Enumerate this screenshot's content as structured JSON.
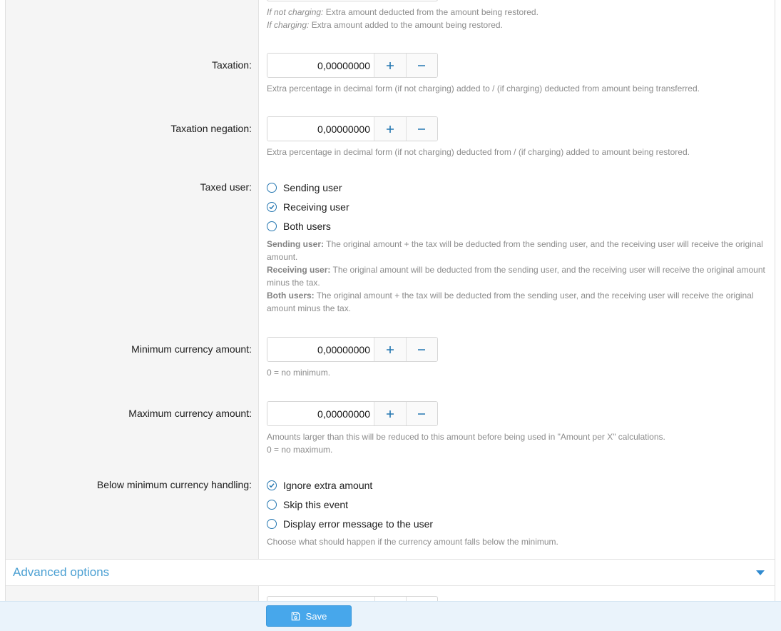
{
  "top_hint": {
    "not_charging_label": "If not charging:",
    "not_charging_text": " Extra amount deducted from the amount being restored.",
    "charging_label": "If charging:",
    "charging_text": " Extra amount added to the amount being restored."
  },
  "taxation": {
    "label": "Taxation:",
    "value": "0,00000000",
    "hint": "Extra percentage in decimal form (if not charging) added to / (if charging) deducted from amount being transferred."
  },
  "taxation_negation": {
    "label": "Taxation negation:",
    "value": "0,00000000",
    "hint": "Extra percentage in decimal form (if not charging) deducted from / (if charging) added to amount being restored."
  },
  "taxed_user": {
    "label": "Taxed user:",
    "options": [
      {
        "label": "Sending user",
        "selected": false
      },
      {
        "label": "Receiving user",
        "selected": true
      },
      {
        "label": "Both users",
        "selected": false
      }
    ],
    "hint_sending_label": "Sending user:",
    "hint_sending_text": " The original amount + the tax will be deducted from the sending user, and the receiving user will receive the original amount.",
    "hint_receiving_label": "Receiving user:",
    "hint_receiving_text": " The original amount will be deducted from the sending user, and the receiving user will receive the original amount minus the tax.",
    "hint_both_label": "Both users:",
    "hint_both_text": " The original amount + the tax will be deducted from the sending user, and the receiving user will receive the original amount minus the tax."
  },
  "min_currency": {
    "label": "Minimum currency amount:",
    "value": "0,00000000",
    "hint": "0 = no minimum."
  },
  "max_currency": {
    "label": "Maximum currency amount:",
    "value": "0,00000000",
    "hint_line1": "Amounts larger than this will be reduced to this amount before being used in \"Amount per X\" calculations.",
    "hint_line2": "0 = no maximum."
  },
  "below_min": {
    "label": "Below minimum currency handling:",
    "options": [
      {
        "label": "Ignore extra amount",
        "selected": true
      },
      {
        "label": "Skip this event",
        "selected": false
      },
      {
        "label": "Display error message to the user",
        "selected": false
      }
    ],
    "hint": "Choose what should happen if the currency amount falls below the minimum."
  },
  "advanced": {
    "title": "Advanced options"
  },
  "footer": {
    "save_label": "Save"
  },
  "icons": {
    "plus": "plus-icon",
    "minus": "minus-icon",
    "check": "check-icon",
    "save": "floppy-disk-icon",
    "caret": "caret-down-icon"
  },
  "colors": {
    "accent": "#2577b1",
    "link": "#4a9fd2",
    "save_button": "#47a7eb",
    "footer_bg": "#eaf3fb"
  }
}
